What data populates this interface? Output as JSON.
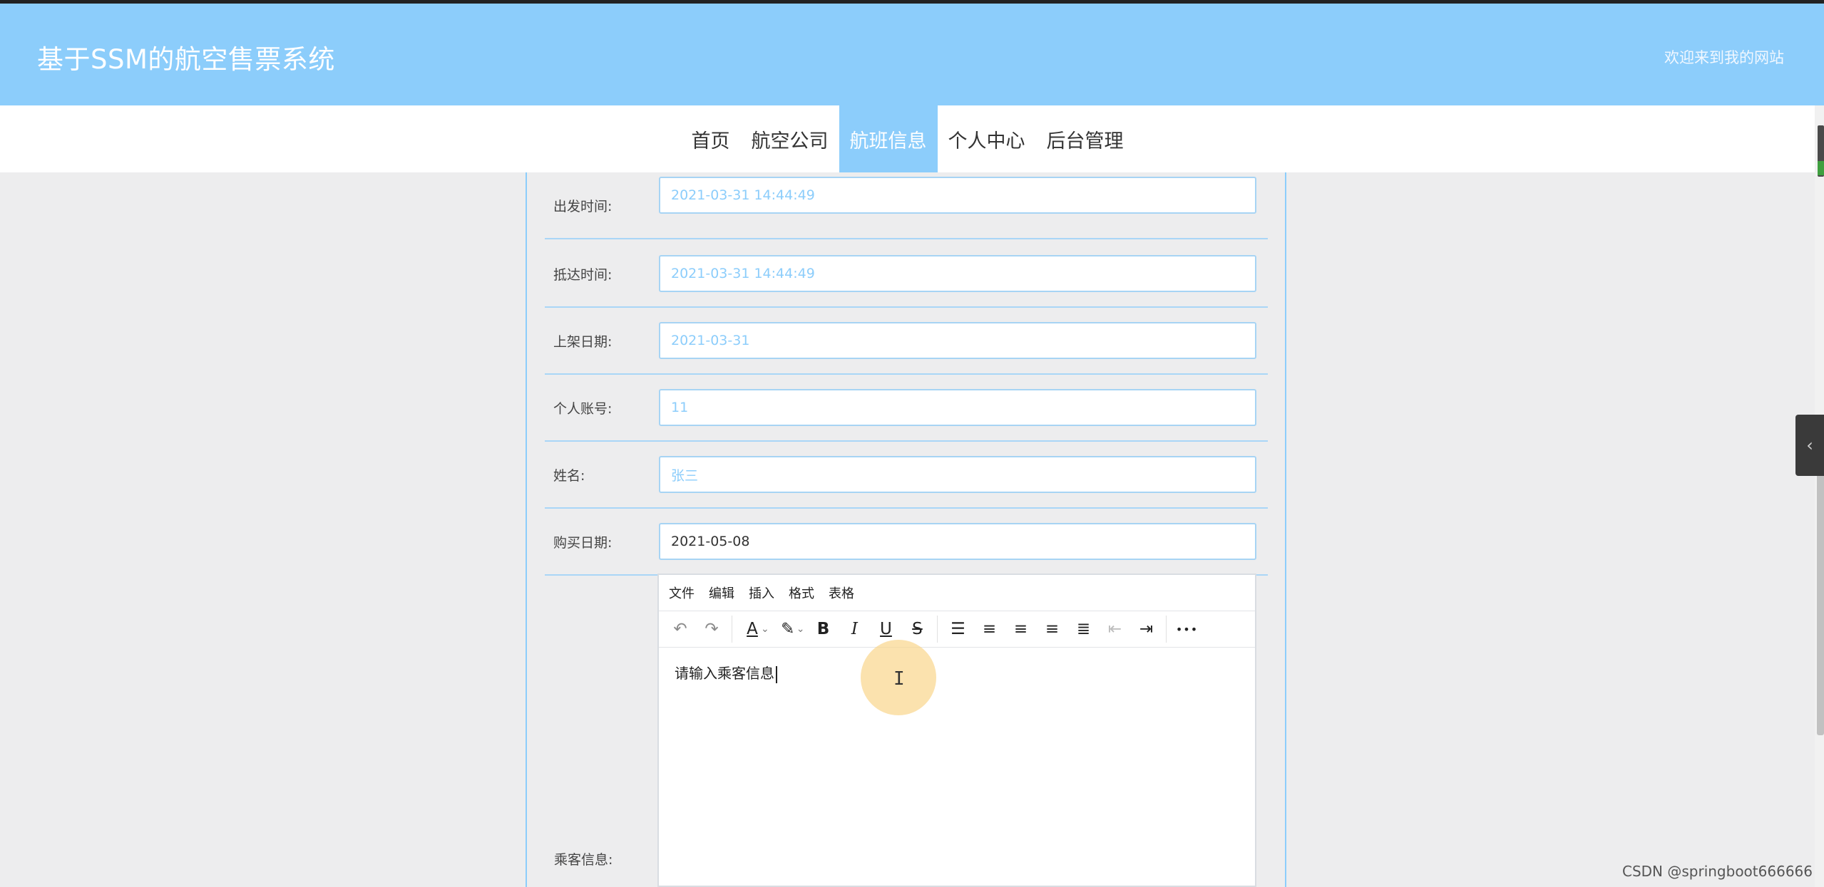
{
  "header": {
    "site_title": "基于SSM的航空售票系统",
    "welcome": "欢迎来到我的网站"
  },
  "nav": {
    "items": [
      {
        "label": "首页"
      },
      {
        "label": "航空公司"
      },
      {
        "label": "航班信息"
      },
      {
        "label": "个人中心"
      },
      {
        "label": "后台管理"
      }
    ]
  },
  "form": {
    "rows": [
      {
        "label": "出发时间:",
        "value": "2021-03-31 14:44:49"
      },
      {
        "label": "抵达时间:",
        "value": "2021-03-31 14:44:49"
      },
      {
        "label": "上架日期:",
        "value": "2021-03-31"
      },
      {
        "label": "个人账号:",
        "value": "11"
      },
      {
        "label": "姓名:",
        "value": "张三"
      },
      {
        "label": "购买日期:",
        "value": "2021-05-08"
      }
    ],
    "passenger_label": "乘客信息:"
  },
  "editor": {
    "menu": [
      "文件",
      "编辑",
      "插入",
      "格式",
      "表格"
    ],
    "toolbar_icons": {
      "undo": "↶",
      "redo": "↷",
      "font_color": "A",
      "highlight": "✎",
      "bold": "B",
      "italic": "I",
      "underline": "U",
      "strike": "S",
      "line_height": "☰",
      "align_left": "≡",
      "align_center": "≡",
      "align_right": "≡",
      "justify": "≣",
      "outdent": "⇤",
      "indent": "⇥",
      "more": "•••",
      "dropdown": "⌄"
    },
    "content": "请输入乘客信息"
  },
  "side_toggle_icon": "‹",
  "cursor_icon": "I",
  "watermark": "CSDN @springboot666666"
}
